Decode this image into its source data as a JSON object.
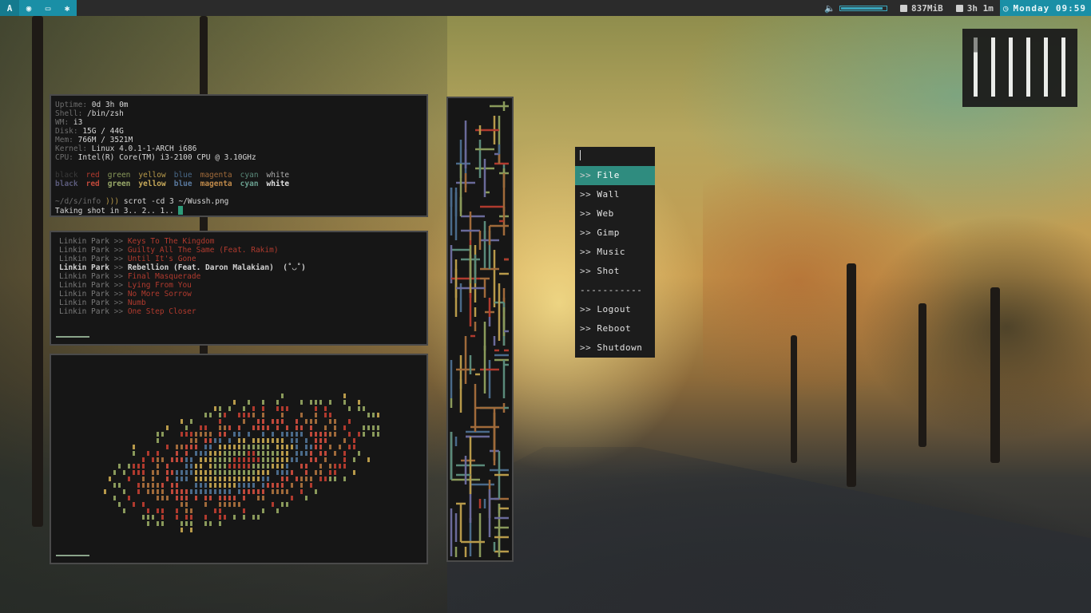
{
  "topbar": {
    "workspaces": [
      {
        "icon": "arch-logo-icon",
        "glyph": "A",
        "active": true
      },
      {
        "icon": "headphones-icon",
        "glyph": "◉",
        "active": false
      },
      {
        "icon": "monitor-icon",
        "glyph": "▭",
        "active": false
      },
      {
        "icon": "settings-icon",
        "glyph": "✱",
        "active": false
      }
    ],
    "volume": {
      "icon": "speaker-icon",
      "level": 0.92
    },
    "memory": "837MiB",
    "uptime": "3h 1m",
    "clock": "Monday 09:59",
    "accent": "#1a8fa6"
  },
  "info": {
    "rows": [
      {
        "label": "Uptime:",
        "value": "0d 3h 0m"
      },
      {
        "label": "Shell:",
        "value": "/bin/zsh"
      },
      {
        "label": "WM:",
        "value": "i3"
      },
      {
        "label": "Disk:",
        "value": "15G / 44G"
      },
      {
        "label": "Mem:",
        "value": "766M / 3521M"
      },
      {
        "label": "Kernel:",
        "value": "Linux 4.0.1-1-ARCH i686"
      },
      {
        "label": "CPU:",
        "value": "Intel(R) Core(TM) i3-2100 CPU @ 3.10GHz"
      }
    ],
    "colors_normal": [
      {
        "name": "black",
        "color": "#3a3a3a"
      },
      {
        "name": "red",
        "color": "#b03a2e"
      },
      {
        "name": "green",
        "color": "#8a9a5b"
      },
      {
        "name": "yellow",
        "color": "#b89a4a"
      },
      {
        "name": "blue",
        "color": "#4a6a8a"
      },
      {
        "name": "magenta",
        "color": "#a06a3a"
      },
      {
        "name": "cyan",
        "color": "#5a8a7a"
      },
      {
        "name": "white",
        "color": "#b0b0b0"
      }
    ],
    "colors_bold": [
      {
        "name": "black",
        "color": "#5a5a7a"
      },
      {
        "name": "red",
        "color": "#c0483a"
      },
      {
        "name": "green",
        "color": "#9aaa6a"
      },
      {
        "name": "yellow",
        "color": "#c8aa5a"
      },
      {
        "name": "blue",
        "color": "#5a7aa0"
      },
      {
        "name": "magenta",
        "color": "#c08a4a"
      },
      {
        "name": "cyan",
        "color": "#6aa090"
      },
      {
        "name": "white",
        "color": "#e0e0e0"
      }
    ],
    "prompt": "~/d/s/info",
    "prompt_symbol": ")))",
    "command": "scrot -cd 3 ~/Wussh.png",
    "output": "Taking shot in 3.. 2.. 1.."
  },
  "music": {
    "separator": ">>",
    "tracks": [
      {
        "artist": "Linkin Park",
        "title": "Keys To The Kingdom",
        "playing": false
      },
      {
        "artist": "Linkin Park",
        "title": "Guilty All The Same (Feat. Rakim)",
        "playing": false
      },
      {
        "artist": "Linkin Park",
        "title": "Until It's Gone",
        "playing": false
      },
      {
        "artist": "Linkin Park",
        "title": "Rebellion (Feat. Daron Malakian)  (˚◡˚)",
        "playing": true
      },
      {
        "artist": "Linkin Park",
        "title": "Final Masquerade",
        "playing": false
      },
      {
        "artist": "Linkin Park",
        "title": "Lying From You",
        "playing": false
      },
      {
        "artist": "Linkin Park",
        "title": "No More Sorrow",
        "playing": false
      },
      {
        "artist": "Linkin Park",
        "title": "Numb",
        "playing": false
      },
      {
        "artist": "Linkin Park",
        "title": "One Step Closer",
        "playing": false
      }
    ]
  },
  "menu": {
    "arrow": ">>",
    "items": [
      {
        "label": "File",
        "selected": true
      },
      {
        "label": "Wall",
        "selected": false
      },
      {
        "label": "Web",
        "selected": false
      },
      {
        "label": "Gimp",
        "selected": false
      },
      {
        "label": "Music",
        "selected": false
      },
      {
        "label": "Shot",
        "selected": false
      },
      {
        "label": "-----------",
        "separator": true
      },
      {
        "label": "Logout",
        "selected": false
      },
      {
        "label": "Reboot",
        "selected": false
      },
      {
        "label": "Shutdown",
        "selected": false
      }
    ]
  },
  "workspace_bars": {
    "count": 6,
    "first_partial": true
  }
}
